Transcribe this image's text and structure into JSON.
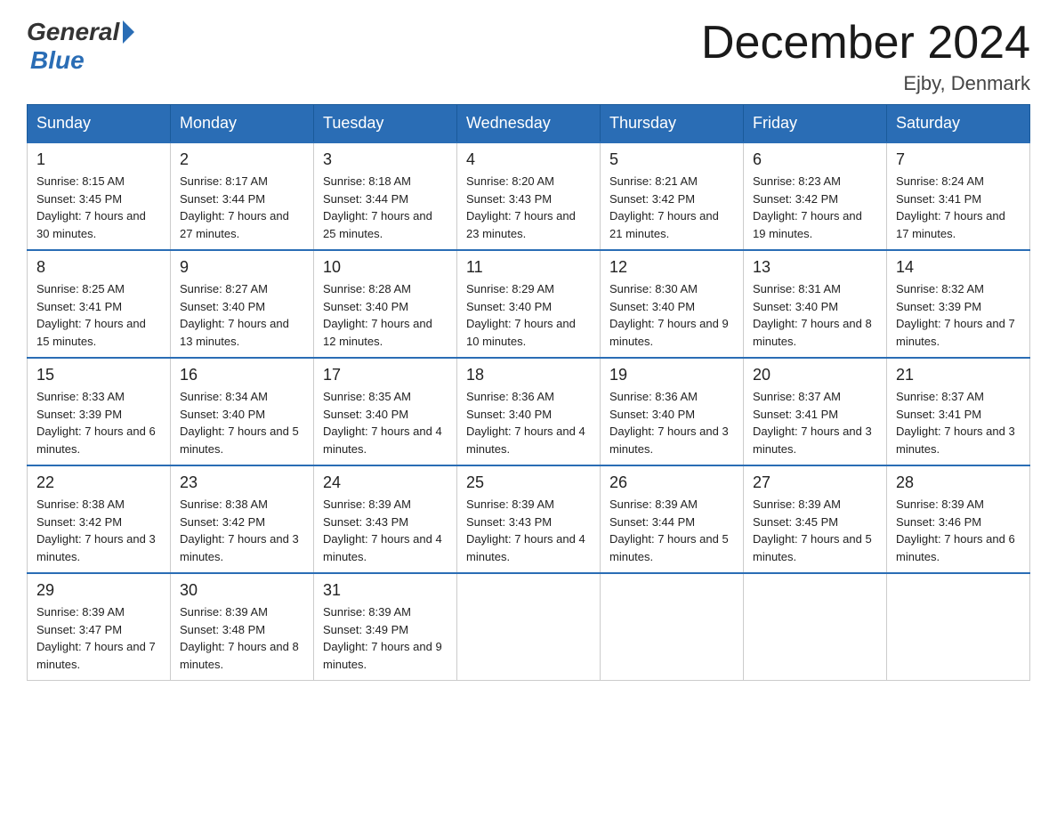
{
  "header": {
    "logo": {
      "general": "General",
      "blue": "Blue"
    },
    "title": "December 2024",
    "location": "Ejby, Denmark"
  },
  "weekdays": [
    "Sunday",
    "Monday",
    "Tuesday",
    "Wednesday",
    "Thursday",
    "Friday",
    "Saturday"
  ],
  "weeks": [
    [
      {
        "day": 1,
        "sunrise": "8:15 AM",
        "sunset": "3:45 PM",
        "daylight": "7 hours and 30 minutes."
      },
      {
        "day": 2,
        "sunrise": "8:17 AM",
        "sunset": "3:44 PM",
        "daylight": "7 hours and 27 minutes."
      },
      {
        "day": 3,
        "sunrise": "8:18 AM",
        "sunset": "3:44 PM",
        "daylight": "7 hours and 25 minutes."
      },
      {
        "day": 4,
        "sunrise": "8:20 AM",
        "sunset": "3:43 PM",
        "daylight": "7 hours and 23 minutes."
      },
      {
        "day": 5,
        "sunrise": "8:21 AM",
        "sunset": "3:42 PM",
        "daylight": "7 hours and 21 minutes."
      },
      {
        "day": 6,
        "sunrise": "8:23 AM",
        "sunset": "3:42 PM",
        "daylight": "7 hours and 19 minutes."
      },
      {
        "day": 7,
        "sunrise": "8:24 AM",
        "sunset": "3:41 PM",
        "daylight": "7 hours and 17 minutes."
      }
    ],
    [
      {
        "day": 8,
        "sunrise": "8:25 AM",
        "sunset": "3:41 PM",
        "daylight": "7 hours and 15 minutes."
      },
      {
        "day": 9,
        "sunrise": "8:27 AM",
        "sunset": "3:40 PM",
        "daylight": "7 hours and 13 minutes."
      },
      {
        "day": 10,
        "sunrise": "8:28 AM",
        "sunset": "3:40 PM",
        "daylight": "7 hours and 12 minutes."
      },
      {
        "day": 11,
        "sunrise": "8:29 AM",
        "sunset": "3:40 PM",
        "daylight": "7 hours and 10 minutes."
      },
      {
        "day": 12,
        "sunrise": "8:30 AM",
        "sunset": "3:40 PM",
        "daylight": "7 hours and 9 minutes."
      },
      {
        "day": 13,
        "sunrise": "8:31 AM",
        "sunset": "3:40 PM",
        "daylight": "7 hours and 8 minutes."
      },
      {
        "day": 14,
        "sunrise": "8:32 AM",
        "sunset": "3:39 PM",
        "daylight": "7 hours and 7 minutes."
      }
    ],
    [
      {
        "day": 15,
        "sunrise": "8:33 AM",
        "sunset": "3:39 PM",
        "daylight": "7 hours and 6 minutes."
      },
      {
        "day": 16,
        "sunrise": "8:34 AM",
        "sunset": "3:40 PM",
        "daylight": "7 hours and 5 minutes."
      },
      {
        "day": 17,
        "sunrise": "8:35 AM",
        "sunset": "3:40 PM",
        "daylight": "7 hours and 4 minutes."
      },
      {
        "day": 18,
        "sunrise": "8:36 AM",
        "sunset": "3:40 PM",
        "daylight": "7 hours and 4 minutes."
      },
      {
        "day": 19,
        "sunrise": "8:36 AM",
        "sunset": "3:40 PM",
        "daylight": "7 hours and 3 minutes."
      },
      {
        "day": 20,
        "sunrise": "8:37 AM",
        "sunset": "3:41 PM",
        "daylight": "7 hours and 3 minutes."
      },
      {
        "day": 21,
        "sunrise": "8:37 AM",
        "sunset": "3:41 PM",
        "daylight": "7 hours and 3 minutes."
      }
    ],
    [
      {
        "day": 22,
        "sunrise": "8:38 AM",
        "sunset": "3:42 PM",
        "daylight": "7 hours and 3 minutes."
      },
      {
        "day": 23,
        "sunrise": "8:38 AM",
        "sunset": "3:42 PM",
        "daylight": "7 hours and 3 minutes."
      },
      {
        "day": 24,
        "sunrise": "8:39 AM",
        "sunset": "3:43 PM",
        "daylight": "7 hours and 4 minutes."
      },
      {
        "day": 25,
        "sunrise": "8:39 AM",
        "sunset": "3:43 PM",
        "daylight": "7 hours and 4 minutes."
      },
      {
        "day": 26,
        "sunrise": "8:39 AM",
        "sunset": "3:44 PM",
        "daylight": "7 hours and 5 minutes."
      },
      {
        "day": 27,
        "sunrise": "8:39 AM",
        "sunset": "3:45 PM",
        "daylight": "7 hours and 5 minutes."
      },
      {
        "day": 28,
        "sunrise": "8:39 AM",
        "sunset": "3:46 PM",
        "daylight": "7 hours and 6 minutes."
      }
    ],
    [
      {
        "day": 29,
        "sunrise": "8:39 AM",
        "sunset": "3:47 PM",
        "daylight": "7 hours and 7 minutes."
      },
      {
        "day": 30,
        "sunrise": "8:39 AM",
        "sunset": "3:48 PM",
        "daylight": "7 hours and 8 minutes."
      },
      {
        "day": 31,
        "sunrise": "8:39 AM",
        "sunset": "3:49 PM",
        "daylight": "7 hours and 9 minutes."
      },
      null,
      null,
      null,
      null
    ]
  ]
}
